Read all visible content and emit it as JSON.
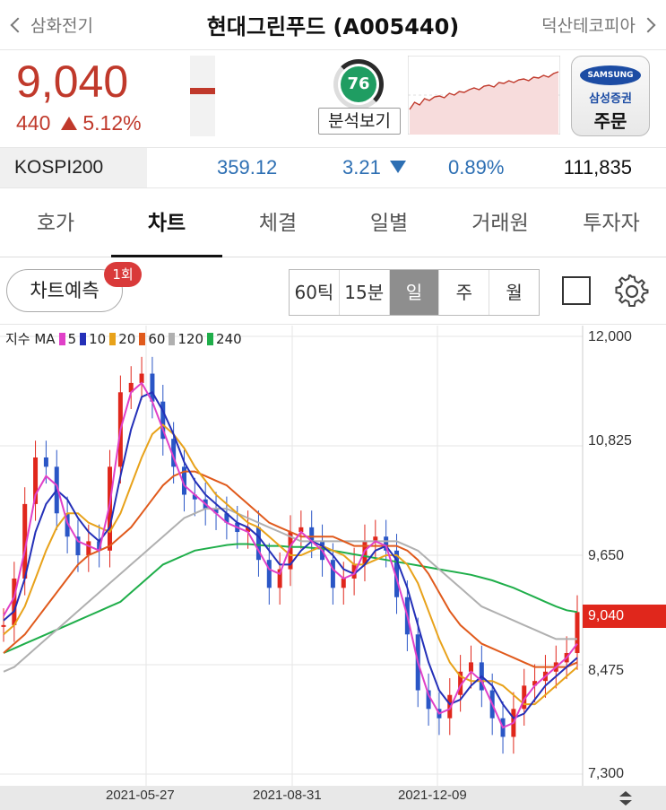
{
  "header": {
    "prev_label": "삼화전기",
    "title": "현대그린푸드 (A005440)",
    "next_label": "덕산테코피아"
  },
  "quote": {
    "price": "9,040",
    "change": "440",
    "change_pct": "5.12%",
    "direction": "up",
    "up_color": "#c0392b"
  },
  "analysis": {
    "score": "76",
    "button_label": "분석보기"
  },
  "order": {
    "brand": "SAMSUNG",
    "broker": "삼성증권",
    "label": "주문"
  },
  "index": {
    "name": "KOSPI200",
    "value": "359.12",
    "change": "3.21",
    "direction": "down",
    "pct": "0.89%",
    "volume": "111,835",
    "down_color": "#2d6fb3"
  },
  "tabs": [
    {
      "label": "호가",
      "active": false
    },
    {
      "label": "차트",
      "active": true
    },
    {
      "label": "체결",
      "active": false
    },
    {
      "label": "일별",
      "active": false
    },
    {
      "label": "거래원",
      "active": false
    },
    {
      "label": "투자자",
      "active": false
    }
  ],
  "toolbar": {
    "predict_label": "차트예측",
    "predict_badge": "1회",
    "periods": [
      "60틱",
      "15분",
      "일",
      "주",
      "월"
    ],
    "active_period": "일"
  },
  "chart_data": {
    "type": "line",
    "legend_prefix": "지수 MA",
    "ma_series": [
      {
        "name": "5",
        "color": "#e040c8"
      },
      {
        "name": "10",
        "color": "#2430b8"
      },
      {
        "name": "20",
        "color": "#e8a21a"
      },
      {
        "name": "60",
        "color": "#e05a1c"
      },
      {
        "name": "120",
        "color": "#b0b0b0"
      },
      {
        "name": "240",
        "color": "#1fae4a"
      }
    ],
    "y_ticks": [
      "12,000",
      "10,825",
      "9,650",
      "8,475",
      "7,300"
    ],
    "ylim": [
      7300,
      12000
    ],
    "x_ticks": [
      "2021-05-27",
      "2021-08-31",
      "2021-12-09"
    ],
    "current_price_label": "9,040",
    "current_price": 9040,
    "candles": [
      8900,
      9400,
      10200,
      10700,
      10600,
      10100,
      9850,
      9650,
      9800,
      9700,
      10600,
      11400,
      11500,
      11600,
      11300,
      10900,
      10600,
      10300,
      10250,
      10150,
      10100,
      10000,
      9900,
      9950,
      9600,
      9300,
      9500,
      9900,
      9950,
      9800,
      9600,
      9300,
      9400,
      9550,
      9800,
      9850,
      9700,
      9200,
      8800,
      8200,
      8000,
      7900,
      8150,
      8400,
      8500,
      8200,
      7900,
      7700,
      8000,
      8250,
      8300,
      8400,
      8500,
      8600,
      9040
    ],
    "ma5": [
      9000,
      9200,
      9700,
      10300,
      10500,
      10400,
      10000,
      9800,
      9750,
      9700,
      10200,
      11000,
      11400,
      11500,
      11300,
      11000,
      10700,
      10400,
      10300,
      10200,
      10100,
      10000,
      9950,
      9900,
      9700,
      9500,
      9450,
      9750,
      9900,
      9800,
      9700,
      9500,
      9400,
      9450,
      9700,
      9800,
      9750,
      9400,
      9000,
      8500,
      8150,
      7950,
      8000,
      8250,
      8400,
      8300,
      8050,
      7800,
      7850,
      8100,
      8250,
      8350,
      8450,
      8550,
      8700
    ],
    "ma10": [
      8950,
      9050,
      9400,
      9900,
      10200,
      10350,
      10250,
      10050,
      9900,
      9800,
      9950,
      10500,
      11000,
      11350,
      11400,
      11200,
      10950,
      10650,
      10450,
      10300,
      10200,
      10100,
      10000,
      9950,
      9850,
      9700,
      9550,
      9550,
      9700,
      9800,
      9750,
      9650,
      9500,
      9450,
      9550,
      9700,
      9750,
      9600,
      9300,
      8900,
      8500,
      8200,
      8050,
      8100,
      8250,
      8350,
      8250,
      8050,
      7900,
      7950,
      8100,
      8250,
      8350,
      8450,
      8550
    ],
    "ma20": [
      8800,
      8900,
      9100,
      9400,
      9700,
      9950,
      10100,
      10100,
      10000,
      9950,
      9900,
      10100,
      10400,
      10700,
      10950,
      11050,
      10950,
      10800,
      10600,
      10450,
      10300,
      10200,
      10100,
      10000,
      9950,
      9850,
      9750,
      9650,
      9650,
      9700,
      9750,
      9700,
      9650,
      9550,
      9550,
      9600,
      9650,
      9650,
      9550,
      9350,
      9050,
      8750,
      8500,
      8350,
      8300,
      8300,
      8300,
      8250,
      8150,
      8050,
      8050,
      8150,
      8250,
      8350,
      8450
    ],
    "ma60": [
      8600,
      8700,
      8800,
      8950,
      9100,
      9250,
      9400,
      9550,
      9650,
      9700,
      9750,
      9850,
      9950,
      10100,
      10250,
      10400,
      10500,
      10550,
      10550,
      10500,
      10450,
      10400,
      10300,
      10200,
      10100,
      10000,
      9950,
      9900,
      9850,
      9850,
      9850,
      9850,
      9800,
      9750,
      9750,
      9750,
      9750,
      9750,
      9700,
      9600,
      9450,
      9250,
      9050,
      8900,
      8800,
      8700,
      8650,
      8600,
      8550,
      8500,
      8450,
      8450,
      8450,
      8450,
      8500
    ],
    "ma120": [
      8400,
      8450,
      8550,
      8650,
      8750,
      8850,
      8950,
      9050,
      9150,
      9250,
      9350,
      9450,
      9550,
      9650,
      9750,
      9850,
      9950,
      10050,
      10100,
      10150,
      10150,
      10150,
      10100,
      10050,
      10000,
      9950,
      9900,
      9850,
      9800,
      9800,
      9800,
      9800,
      9800,
      9800,
      9800,
      9800,
      9800,
      9800,
      9750,
      9700,
      9600,
      9500,
      9400,
      9300,
      9200,
      9100,
      9050,
      9000,
      8950,
      8900,
      8850,
      8800,
      8750,
      8750,
      8750
    ],
    "ma240": [
      8600,
      8650,
      8700,
      8750,
      8800,
      8850,
      8900,
      8950,
      9000,
      9050,
      9100,
      9150,
      9250,
      9350,
      9450,
      9550,
      9600,
      9650,
      9700,
      9720,
      9740,
      9760,
      9770,
      9770,
      9760,
      9750,
      9750,
      9740,
      9740,
      9730,
      9720,
      9700,
      9680,
      9660,
      9640,
      9620,
      9600,
      9580,
      9560,
      9540,
      9520,
      9500,
      9480,
      9460,
      9440,
      9410,
      9380,
      9340,
      9300,
      9250,
      9200,
      9150,
      9100,
      9060,
      9040
    ]
  }
}
